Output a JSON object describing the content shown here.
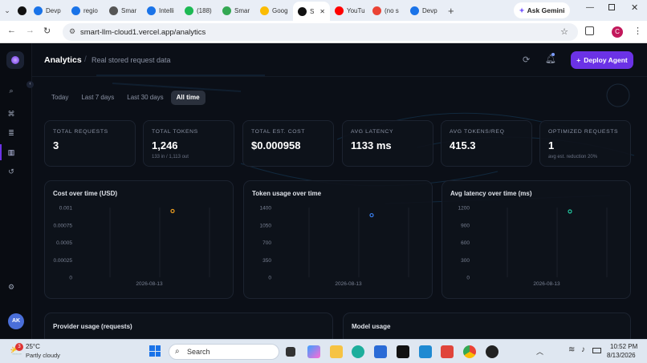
{
  "browser": {
    "tabs": [
      {
        "label": "Devp",
        "color": "#1a73e8"
      },
      {
        "label": "regio",
        "color": "#1a73e8"
      },
      {
        "label": "Smar",
        "color": "#555"
      },
      {
        "label": "Intelli",
        "color": "#1a73e8"
      },
      {
        "label": "(188)",
        "color": "#1db954"
      },
      {
        "label": "Smar",
        "color": "#34a853"
      },
      {
        "label": "Goog",
        "color": "#fbbc04"
      },
      {
        "label": "S",
        "color": "#111"
      },
      {
        "label": "YouTu",
        "color": "#ff0000"
      },
      {
        "label": "(no s",
        "color": "#ea4335"
      },
      {
        "label": "Devp",
        "color": "#1a73e8"
      }
    ],
    "ask_gemini": "Ask Gemini",
    "url": "smart-llm-cloud1.vercel.app/analytics",
    "profile_initial": "C"
  },
  "app": {
    "title": "Analytics",
    "separator": "/",
    "subtitle": "Real stored request data",
    "deploy_label": "Deploy Agent",
    "avatar": "AK"
  },
  "ranges": [
    "Today",
    "Last 7 days",
    "Last 30 days",
    "All time"
  ],
  "active_range": "All time",
  "stats": [
    {
      "label": "TOTAL REQUESTS",
      "value": "3",
      "sub": ""
    },
    {
      "label": "TOTAL TOKENS",
      "value": "1,246",
      "sub": "133 in / 1,113 out"
    },
    {
      "label": "TOTAL EST. COST",
      "value": "$0.000958",
      "sub": ""
    },
    {
      "label": "AVG LATENCY",
      "value": "1133 ms",
      "sub": ""
    },
    {
      "label": "AVG TOKENS/REQ",
      "value": "415.3",
      "sub": ""
    },
    {
      "label": "OPTIMIZED REQUESTS",
      "value": "1",
      "sub": "avg est. reduction 20%"
    }
  ],
  "chart_data": [
    {
      "type": "scatter",
      "title": "Cost over time (USD)",
      "x": [
        "2026-08-13"
      ],
      "y": [
        0.00095
      ],
      "yticks": [
        "0.001",
        "0.00075",
        "0.0005",
        "0.00025",
        "0"
      ],
      "ylim": [
        0,
        0.001
      ],
      "color": "#f0a020"
    },
    {
      "type": "scatter",
      "title": "Token usage over time",
      "x": [
        "2026-08-13"
      ],
      "y": [
        1246
      ],
      "yticks": [
        "1400",
        "1050",
        "700",
        "350",
        "0"
      ],
      "ylim": [
        0,
        1400
      ],
      "color": "#3b82f6"
    },
    {
      "type": "scatter",
      "title": "Avg latency over time (ms)",
      "x": [
        "2026-08-13"
      ],
      "y": [
        1133
      ],
      "yticks": [
        "1200",
        "900",
        "600",
        "300",
        "0"
      ],
      "ylim": [
        0,
        1200
      ],
      "color": "#22c7a0"
    }
  ],
  "sections": {
    "provider": "Provider usage (requests)",
    "model": "Model usage"
  },
  "taskbar": {
    "weather_temp": "25°C",
    "weather_desc": "Partly cloudy",
    "weather_badge": "3",
    "search": "Search",
    "time": "10:52 PM",
    "date": "8/13/2026"
  }
}
